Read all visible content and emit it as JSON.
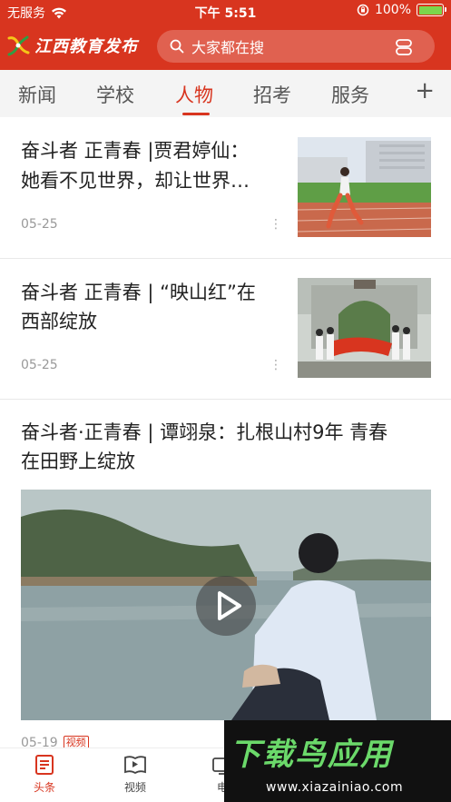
{
  "status_bar": {
    "carrier": "无服务",
    "time": "下午 5:51",
    "battery": "100%"
  },
  "header": {
    "logo_text": "江西教育发布",
    "search_placeholder": "大家都在搜"
  },
  "tabs": [
    {
      "label": "新闻"
    },
    {
      "label": "学校"
    },
    {
      "label": "人物"
    },
    {
      "label": "招考"
    },
    {
      "label": "服务"
    }
  ],
  "active_tab": "人物",
  "articles": [
    {
      "title_line1": "奋斗者 正青春 |贾君婷仙：",
      "title_line2": "她看不见世界，却让世界…",
      "date": "05-25"
    },
    {
      "title_line1": "奋斗者 正青春 | “映山红”在",
      "title_line2": "西部绽放",
      "date": "05-25"
    },
    {
      "title_line1": "奋斗者·正青春 | 谭翊泉：扎根山村9年  青春",
      "title_line2": "在田野上绽放",
      "date": "05-19",
      "badge": "视频"
    }
  ],
  "bottom_nav": [
    {
      "label": "头条"
    },
    {
      "label": "视频"
    },
    {
      "label": "电"
    }
  ],
  "watermark": {
    "title": "下载鸟应用",
    "url": "www.xiazainiao.com"
  },
  "colors": {
    "brand_red": "#d8351f",
    "watermark_green": "#6bd96a"
  }
}
